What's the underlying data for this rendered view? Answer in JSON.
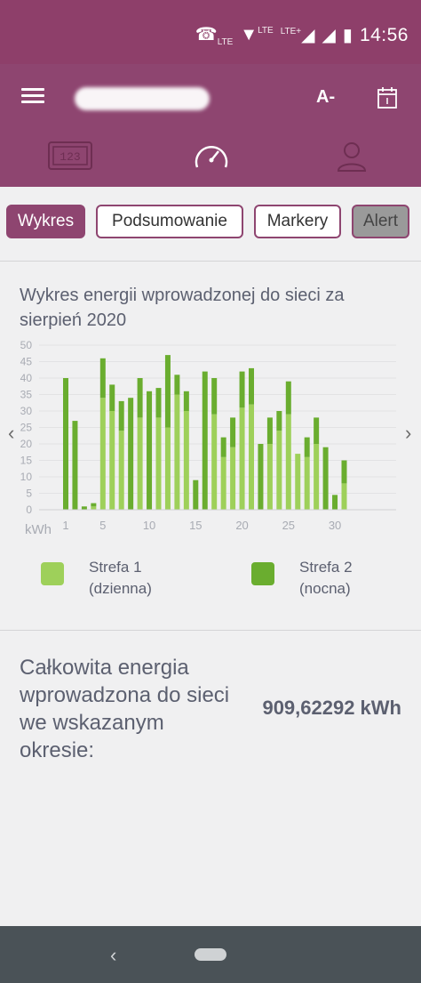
{
  "status_bar": {
    "signal_label": "LTE",
    "wifi_label": "LTE",
    "cell_label": "LTE+",
    "time": "14:56"
  },
  "app_bar": {
    "font_size_label": "A-"
  },
  "tabs": [
    {
      "label": "Wykres",
      "active": true
    },
    {
      "label": "Podsumowanie",
      "active": false
    },
    {
      "label": "Markery",
      "active": false
    },
    {
      "label": "Alert",
      "active": false
    }
  ],
  "chart_title": "Wykres energii wprowadzonej do sieci za sierpień 2020",
  "chart_data": {
    "type": "bar",
    "stacked": true,
    "title": "Wykres energii wprowadzonej do sieci za sierpień 2020",
    "ylabel": "kWh",
    "ylim": [
      0,
      50
    ],
    "yticks": [
      "50",
      "45",
      "40",
      "35",
      "30",
      "25",
      "20",
      "15",
      "10",
      "5",
      "0"
    ],
    "xticks": [
      "1",
      "5",
      "10",
      "15",
      "20",
      "25",
      "30"
    ],
    "categories": [
      1,
      2,
      3,
      4,
      5,
      6,
      7,
      8,
      9,
      10,
      11,
      12,
      13,
      14,
      15,
      16,
      17,
      18,
      19,
      20,
      21,
      22,
      23,
      24,
      25,
      26,
      27,
      28,
      29,
      30,
      31
    ],
    "series": [
      {
        "name": "Strefa 1",
        "color": "#9ed05a",
        "values": [
          0,
          0,
          0,
          1,
          34,
          30,
          24,
          0,
          28,
          0,
          28,
          25,
          35,
          30,
          0,
          0,
          29,
          16,
          19,
          31,
          32,
          0,
          20,
          24,
          29,
          17,
          16,
          20,
          0,
          0,
          8
        ]
      },
      {
        "name": "Strefa 2",
        "color": "#6aad2f",
        "values": [
          40,
          27,
          1,
          1,
          12,
          8,
          9,
          34,
          12,
          36,
          9,
          22,
          6,
          6,
          9,
          42,
          11,
          6,
          9,
          11,
          11,
          20,
          8,
          6,
          10,
          0,
          6,
          8,
          19,
          4.5,
          7
        ]
      }
    ],
    "legend": [
      {
        "title": "Strefa 1",
        "subtitle": "(dzienna)"
      },
      {
        "title": "Strefa 2",
        "subtitle": "(nocna)"
      }
    ]
  },
  "totals": {
    "label": "Całkowita energia wprowadzona do sieci we wskazanym okresie:",
    "value": "909,62292 kWh"
  },
  "colors": {
    "header": "#8e4570",
    "zone1": "#9ed05a",
    "zone2": "#6aad2f",
    "text": "#5c6070"
  }
}
